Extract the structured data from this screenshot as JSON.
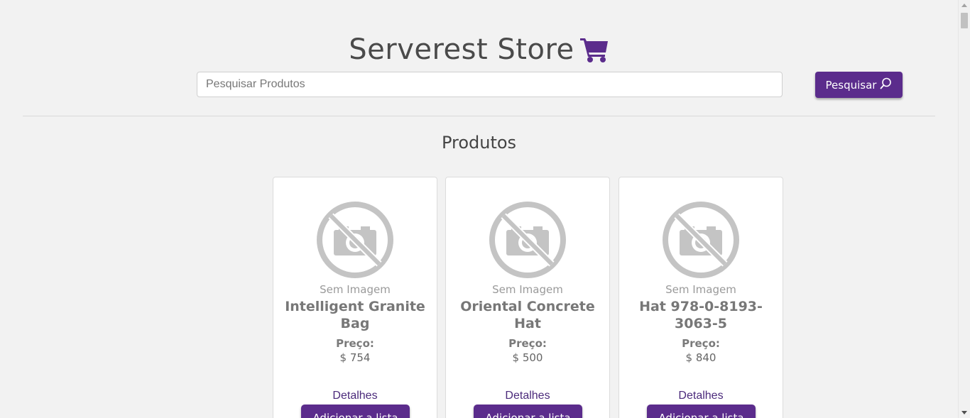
{
  "header": {
    "title": "Serverest Store",
    "cart_icon": "shopping-cart-icon"
  },
  "search": {
    "placeholder": "Pesquisar Produtos",
    "value": "",
    "button_label": "Pesquisar",
    "button_icon": "search-icon"
  },
  "section": {
    "title": "Produtos"
  },
  "products": [
    {
      "no_image_label": "Sem Imagem",
      "name": "Intelligent Granite Bag",
      "price_label": "Preço:",
      "price": "$ 754",
      "details_label": "Detalhes",
      "add_label": "Adicionar a lista"
    },
    {
      "no_image_label": "Sem Imagem",
      "name": "Oriental Concrete Hat",
      "price_label": "Preço:",
      "price": "$ 500",
      "details_label": "Detalhes",
      "add_label": "Adicionar a lista"
    },
    {
      "no_image_label": "Sem Imagem",
      "name": "Hat 978-0-8193-3063-5",
      "price_label": "Preço:",
      "price": "$ 840",
      "details_label": "Detalhes",
      "add_label": "Adicionar a lista"
    }
  ],
  "colors": {
    "accent": "#5b2c8c",
    "background": "#f2f2f2",
    "card": "#ffffff",
    "link": "#4b2a7b"
  }
}
